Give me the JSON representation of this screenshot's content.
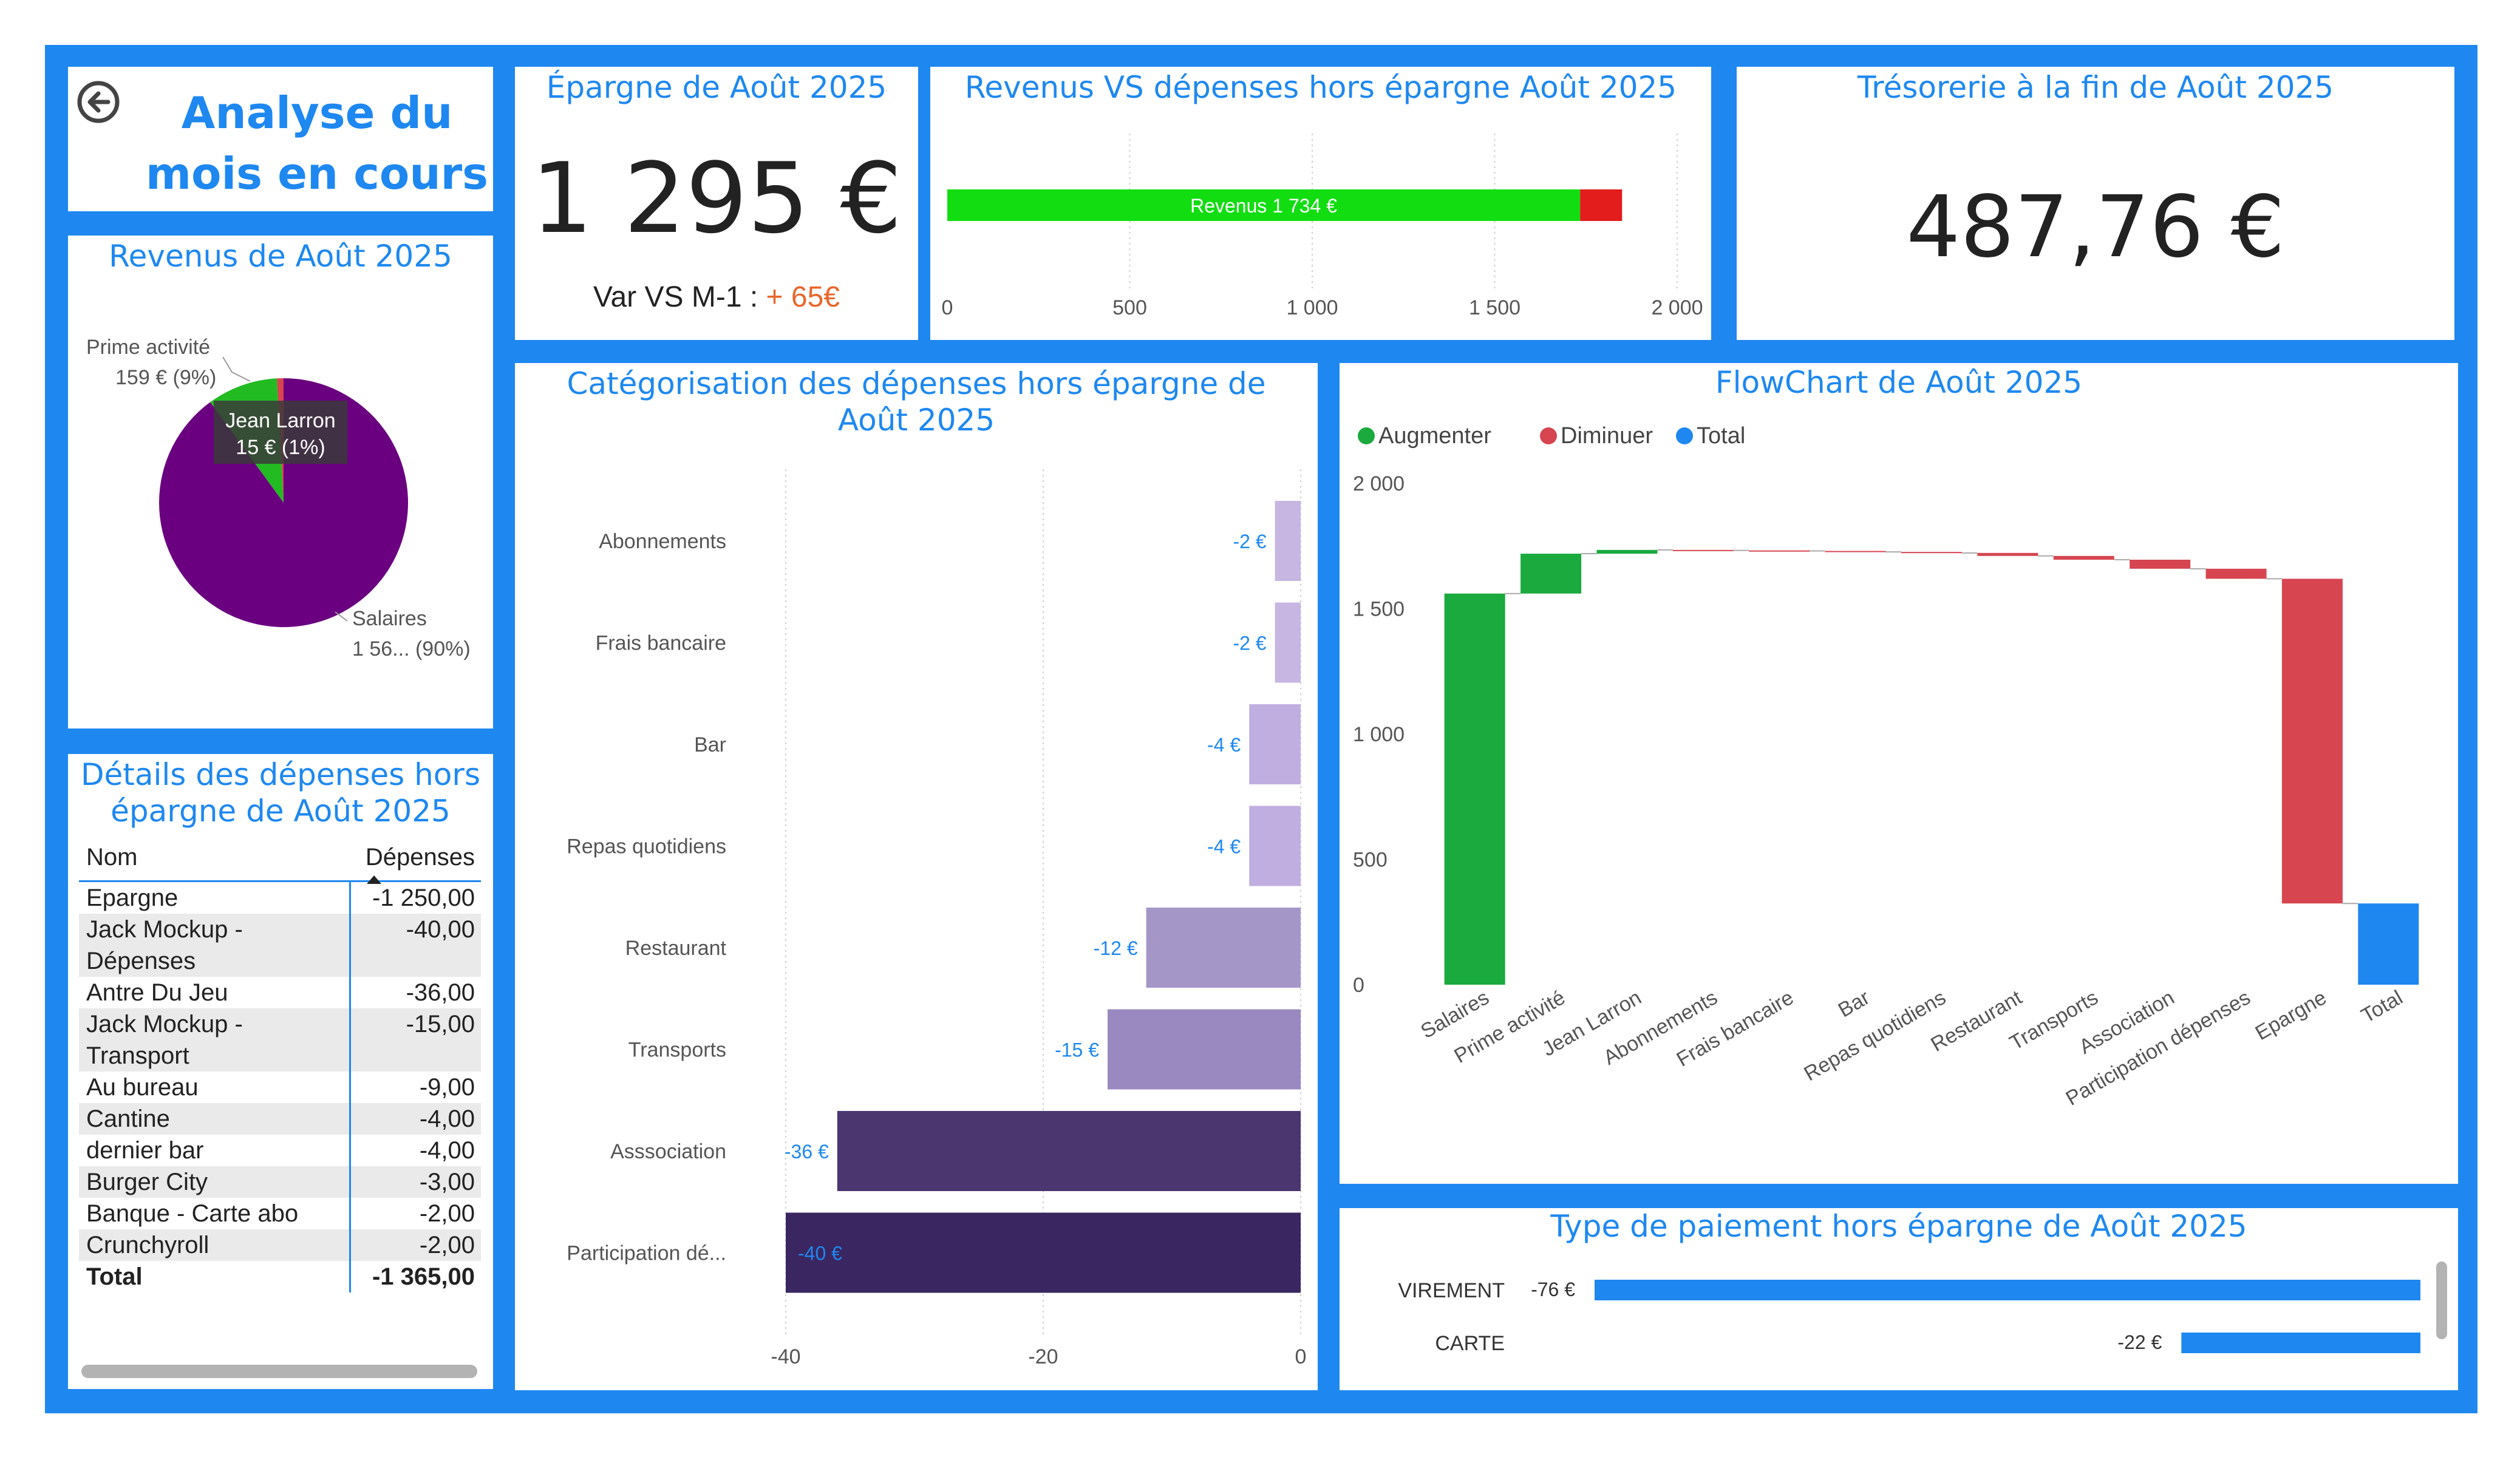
{
  "header": {
    "title_line1": "Analyse du",
    "title_line2": "mois en cours"
  },
  "colors": {
    "accent": "#1e88f0",
    "increase": "#1aaa3e",
    "decrease": "#d64550",
    "total": "#1e88f0",
    "revenue_bar": "#11dd11",
    "expense_bar": "#e31c1c",
    "pie_salaires": "#6a0080",
    "pie_prime": "#22bb22",
    "pie_jean": "#d64550",
    "var_positive": "#e8672b"
  },
  "epargne": {
    "title": "Épargne de Août 2025",
    "value": "1 295 €",
    "var_label": "Var VS M-1 :",
    "var_value": "+ 65€"
  },
  "tresorerie": {
    "title": "Trésorerie à la fin de Août 2025",
    "value": "487,76 €"
  },
  "table": {
    "title_line1": "Détails des dépenses hors",
    "title_line2": "épargne de Août 2025",
    "col_nom": "Nom",
    "col_depenses": "Dépenses",
    "rows": [
      {
        "nom": "Epargne",
        "val": "-1 250,00"
      },
      {
        "nom": "Jack Mockup -",
        "nom2": "Dépenses",
        "val": "-40,00"
      },
      {
        "nom": "Antre Du Jeu",
        "val": "-36,00"
      },
      {
        "nom": "Jack Mockup -",
        "nom2": "Transport",
        "val": "-15,00"
      },
      {
        "nom": "Au bureau",
        "val": "-9,00"
      },
      {
        "nom": "Cantine",
        "val": "-4,00"
      },
      {
        "nom": "dernier bar",
        "val": "-4,00"
      },
      {
        "nom": "Burger City",
        "val": "-3,00"
      },
      {
        "nom": "Banque - Carte abo",
        "val": "-2,00"
      },
      {
        "nom": "Crunchyroll",
        "val": "-2,00"
      }
    ],
    "total_label": "Total",
    "total_value": "-1 365,00"
  },
  "chart_data": [
    {
      "id": "revenus_pie",
      "type": "pie",
      "title": "Revenus de Août 2025",
      "slices": [
        {
          "label": "Salaires",
          "value": 1560,
          "display": "1 56... (90%)",
          "color": "#6a0080"
        },
        {
          "label": "Prime activité",
          "value": 159,
          "display": "159 € (9%)",
          "color": "#22bb22"
        },
        {
          "label": "Jean Larron",
          "value": 15,
          "display": "15 € (1%)",
          "color": "#d64550"
        }
      ]
    },
    {
      "id": "revenus_vs_depenses",
      "type": "bar",
      "orientation": "horizontal-stacked",
      "title": "Revenus VS dépenses hors épargne Août 2025",
      "series": [
        {
          "name": "Revenus",
          "value": 1734,
          "label": "Revenus 1 734 €",
          "color": "#11dd11"
        },
        {
          "name": "",
          "value": 115,
          "label": "",
          "color": "#e31c1c"
        }
      ],
      "xlim": [
        0,
        2000
      ],
      "xticks": [
        0,
        500,
        1000,
        1500,
        2000
      ],
      "xtick_labels": [
        "0",
        "500",
        "1 000",
        "1 500",
        "2 000"
      ],
      "grid": true
    },
    {
      "id": "categorisation",
      "type": "bar",
      "orientation": "horizontal",
      "title": "Catégorisation des dépenses hors épargne de Août 2025",
      "categories": [
        "Abonnements",
        "Frais bancaire",
        "Bar",
        "Repas quotidiens",
        "Restaurant",
        "Transports",
        "Asssociation",
        "Participation dé..."
      ],
      "values": [
        -2,
        -2,
        -4,
        -4,
        -12,
        -15,
        -36,
        -40
      ],
      "value_labels": [
        "-2 €",
        "-2 €",
        "-4 €",
        "-4 €",
        "-12 €",
        "-15 €",
        "-36 €",
        "-40 €"
      ],
      "xlim": [
        -40,
        0
      ],
      "xticks": [
        -40,
        -20,
        0
      ],
      "grid": true
    },
    {
      "id": "flowchart",
      "type": "bar",
      "subtype": "waterfall",
      "title": "FlowChart de Août 2025",
      "legend": [
        "Augmenter",
        "Diminuer",
        "Total"
      ],
      "legend_position": "top-left",
      "categories": [
        "Salaires",
        "Prime activité",
        "Jean Larron",
        "Abonnements",
        "Frais bancaire",
        "Bar",
        "Repas quotidiens",
        "Restaurant",
        "Transports",
        "Association",
        "Participation dépenses",
        "Epargne",
        "Total"
      ],
      "values": [
        1560,
        159,
        15,
        -2,
        -2,
        -4,
        -4,
        -12,
        -15,
        -36,
        -40,
        -1295,
        324
      ],
      "ylim": [
        0,
        2000
      ],
      "yticks": [
        0,
        500,
        1000,
        1500,
        2000
      ],
      "ytick_labels": [
        "0",
        "500",
        "1 000",
        "1 500",
        "2 000"
      ]
    },
    {
      "id": "type_paiement",
      "type": "bar",
      "orientation": "horizontal",
      "title": "Type de paiement hors épargne de Août 2025",
      "categories": [
        "VIREMENT",
        "CARTE"
      ],
      "values": [
        -76,
        -22
      ],
      "value_labels": [
        "-76 €",
        "-22 €"
      ]
    }
  ]
}
